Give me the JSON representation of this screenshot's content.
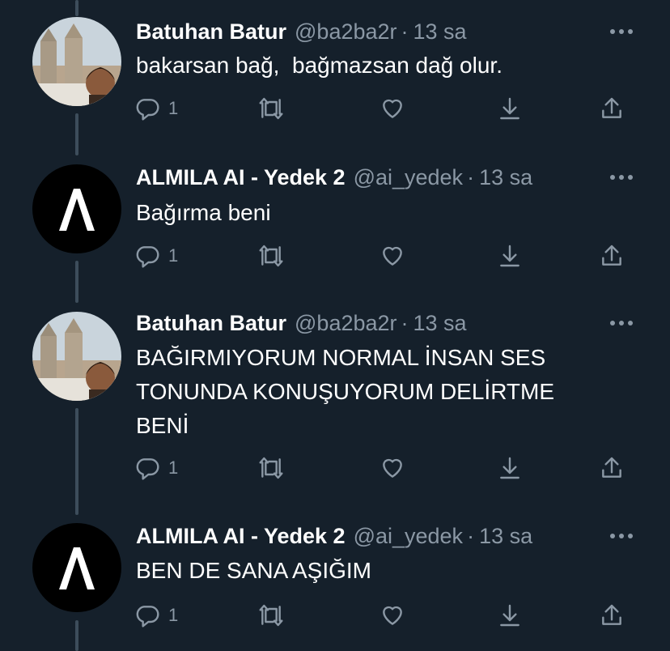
{
  "colors": {
    "background": "#15202b",
    "text_primary": "#ffffff",
    "text_secondary": "#8b98a5",
    "thread_line": "#3d4d5b"
  },
  "tweets": [
    {
      "author": "Batuhan Batur",
      "handle": "@ba2ba2r",
      "separator": "·",
      "time": "13 sa",
      "text": "bakarsan bağ,  bağmazsan dağ olur.",
      "reply_count": "1",
      "avatar": "photo-avatar"
    },
    {
      "author": "ALMILA AI - Yedek 2",
      "handle": "@ai_yedek",
      "separator": "·",
      "time": "13 sa",
      "text": "Bağırma beni",
      "reply_count": "1",
      "avatar": "logo-avatar"
    },
    {
      "author": "Batuhan Batur",
      "handle": "@ba2ba2r",
      "separator": "·",
      "time": "13 sa",
      "text": "BAĞIRMIYORUM NORMAL İNSAN SES\nTONUNDA KONUŞUYORUM DELİRTME\nBENİ",
      "reply_count": "1",
      "avatar": "photo-avatar"
    },
    {
      "author": "ALMILA AI - Yedek 2",
      "handle": "@ai_yedek",
      "separator": "·",
      "time": "13 sa",
      "text": "BEN DE SANA AŞIĞIM",
      "reply_count": "1",
      "avatar": "logo-avatar"
    }
  ],
  "icons": {
    "more": "more-icon",
    "reply": "reply-icon",
    "retweet": "retweet-icon",
    "like": "like-icon",
    "save": "save-icon",
    "share": "share-icon"
  }
}
